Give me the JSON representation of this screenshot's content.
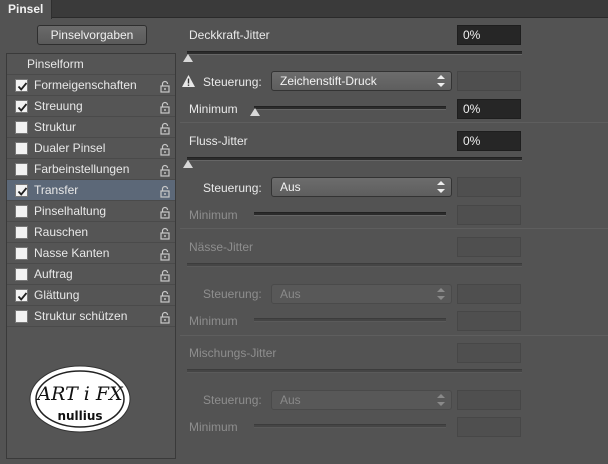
{
  "panel": {
    "tab": "Pinsel"
  },
  "presets_button": "Pinselvorgaben",
  "list": {
    "header": "Pinselform",
    "items": [
      {
        "label": "Formeigenschaften",
        "checked": true,
        "selected": false
      },
      {
        "label": "Streuung",
        "checked": true,
        "selected": false
      },
      {
        "label": "Struktur",
        "checked": false,
        "selected": false
      },
      {
        "label": "Dualer Pinsel",
        "checked": false,
        "selected": false
      },
      {
        "label": "Farbeinstellungen",
        "checked": false,
        "selected": false
      },
      {
        "label": "Transfer",
        "checked": true,
        "selected": true
      },
      {
        "label": "Pinselhaltung",
        "checked": false,
        "selected": false
      },
      {
        "label": "Rauschen",
        "checked": false,
        "selected": false
      },
      {
        "label": "Nasse Kanten",
        "checked": false,
        "selected": false
      },
      {
        "label": "Auftrag",
        "checked": false,
        "selected": false
      },
      {
        "label": "Glättung",
        "checked": true,
        "selected": false
      },
      {
        "label": "Struktur schützen",
        "checked": false,
        "selected": false
      }
    ]
  },
  "logo": {
    "text_top": "ART i FX",
    "text_bottom": "nullius"
  },
  "opacity": {
    "title": "Deckkraft-Jitter",
    "value": "0%",
    "slider_value": 0,
    "control_label": "Steuerung:",
    "control_value": "Zeichenstift-Druck",
    "minimum_label": "Minimum",
    "minimum_value": "0%",
    "minimum_slider_value": 0
  },
  "flow": {
    "title": "Fluss-Jitter",
    "value": "0%",
    "slider_value": 0,
    "control_label": "Steuerung:",
    "control_value": "Aus",
    "minimum_label": "Minimum"
  },
  "wetness": {
    "title": "Nässe-Jitter",
    "control_label": "Steuerung:",
    "control_value": "Aus",
    "minimum_label": "Minimum"
  },
  "mix": {
    "title": "Mischungs-Jitter",
    "control_label": "Steuerung:",
    "control_value": "Aus",
    "minimum_label": "Minimum"
  },
  "colors": {
    "selected_row": "#5c6878",
    "panel_bg": "#535353"
  }
}
